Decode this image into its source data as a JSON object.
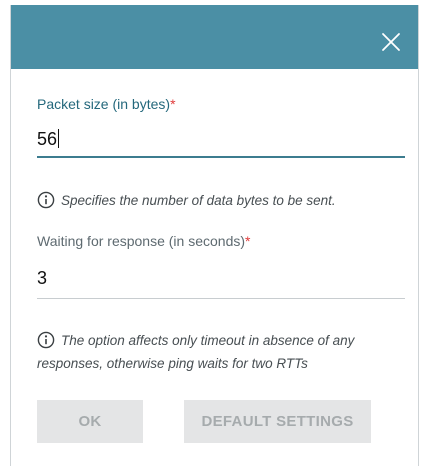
{
  "dialog": {
    "close_icon": "close-icon"
  },
  "fields": {
    "packet_size": {
      "label": "Packet size (in bytes)",
      "required_mark": "*",
      "value": "56",
      "hint": "Specifies the number of data bytes to be sent.",
      "hint_icon": "info-icon"
    },
    "waiting": {
      "label": "Waiting for response (in seconds)",
      "required_mark": "*",
      "value": "3",
      "hint": "The option affects only timeout in absence of any responses, otherwise ping waits for two RTTs",
      "hint_icon": "info-icon"
    }
  },
  "buttons": {
    "ok": "OK",
    "default_settings": "DEFAULT SETTINGS"
  },
  "colors": {
    "header": "#4b8fa5",
    "label_active": "#24687c",
    "required": "#e03b3b",
    "button_bg": "#e4e5e6",
    "button_text": "#a6abad"
  }
}
